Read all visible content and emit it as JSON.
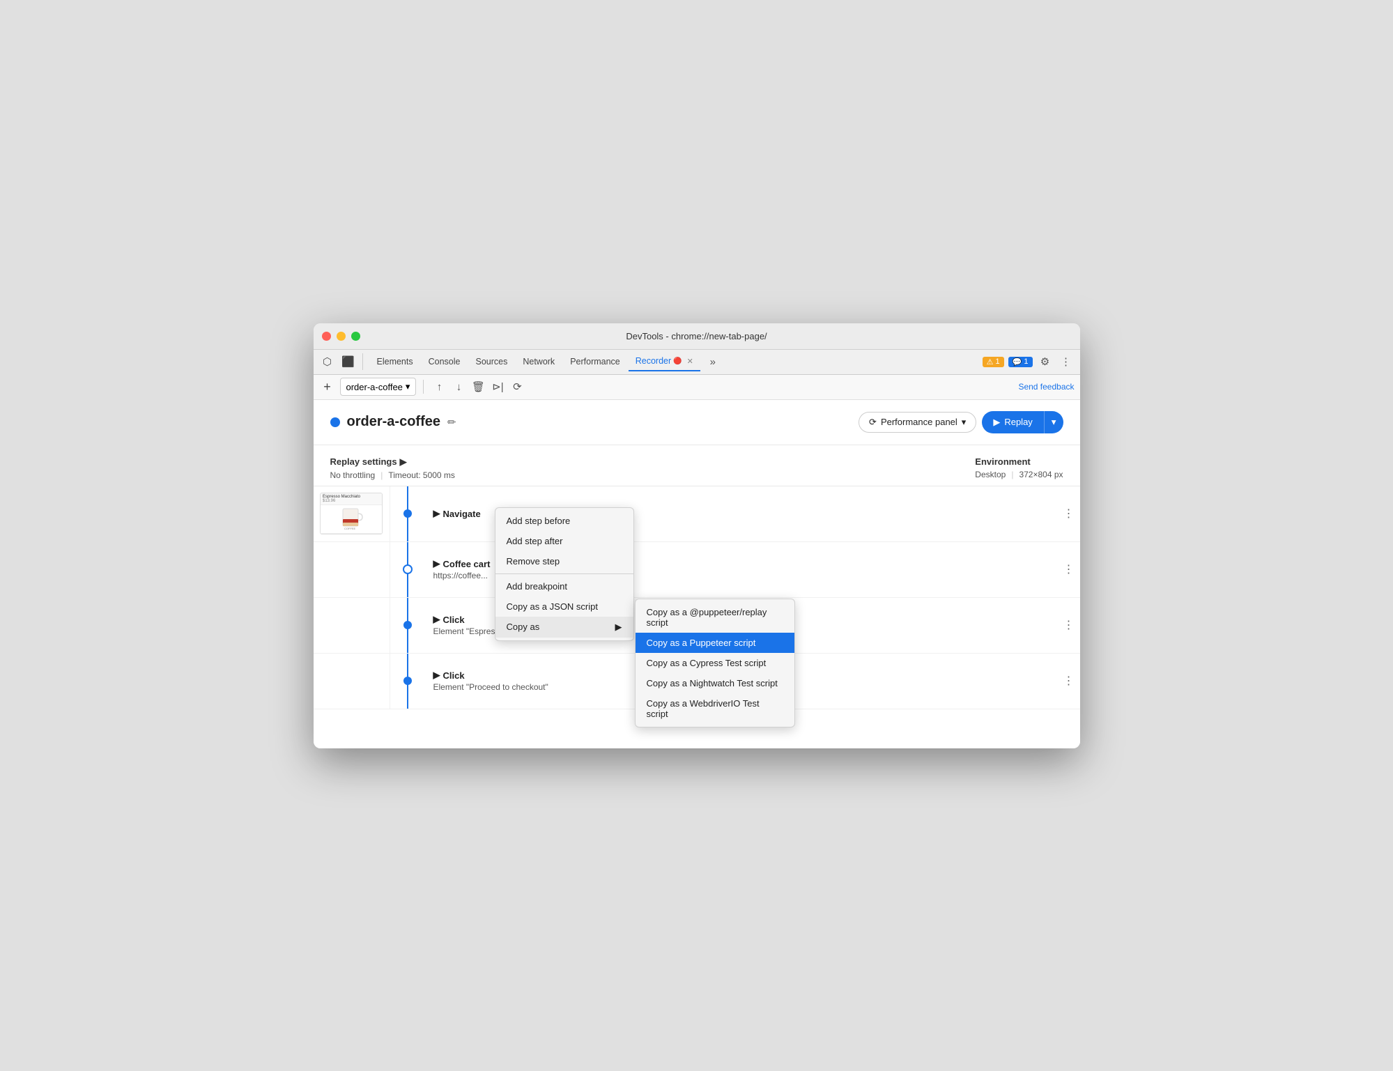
{
  "window": {
    "title": "DevTools - chrome://new-tab-page/"
  },
  "tabs": {
    "items": [
      {
        "label": "Elements",
        "active": false
      },
      {
        "label": "Console",
        "active": false
      },
      {
        "label": "Sources",
        "active": false
      },
      {
        "label": "Network",
        "active": false
      },
      {
        "label": "Performance",
        "active": false
      },
      {
        "label": "Recorder",
        "active": true,
        "closeable": true
      }
    ],
    "more_icon": "»",
    "warn_badge": "⚠ 1",
    "msg_badge": "💬 1",
    "settings_icon": "⚙",
    "more_icon2": "⋮"
  },
  "toolbar": {
    "plus_icon": "+",
    "recording_name": "order-a-coffee",
    "chevron_icon": "▾",
    "export_icon": "↑",
    "import_icon": "↓",
    "delete_icon": "🗑",
    "start_icon": "⊳",
    "settings2_icon": "⟳",
    "send_feedback": "Send feedback"
  },
  "recording": {
    "name": "order-a-coffee",
    "edit_icon": "✏",
    "perf_panel": {
      "label": "Performance panel",
      "icon": "⟳"
    },
    "replay": {
      "label": "Replay",
      "play_icon": "▶",
      "dropdown_icon": "▾"
    }
  },
  "settings": {
    "title": "Replay settings",
    "chevron": "▶",
    "throttling": "No throttling",
    "timeout": "Timeout: 5000 ms",
    "environment_label": "Environment",
    "device": "Desktop",
    "dimensions": "372×804 px"
  },
  "steps": [
    {
      "id": "navigate",
      "name": "Navigate",
      "detail": "",
      "has_preview": true,
      "dot_type": "filled",
      "expanded": false
    },
    {
      "id": "coffee-cart",
      "name": "Coffee cart",
      "detail": "https://coffee...",
      "has_preview": false,
      "dot_type": "outline",
      "expanded": true
    },
    {
      "id": "click-espresso",
      "name": "Click",
      "detail": "Element \"Espresso Macchiato\"",
      "has_preview": false,
      "dot_type": "filled",
      "expanded": false
    },
    {
      "id": "click-checkout",
      "name": "Click",
      "detail": "Element \"Proceed to checkout\"",
      "has_preview": false,
      "dot_type": "filled",
      "expanded": false
    }
  ],
  "context_menu": {
    "items": [
      {
        "label": "Add step before",
        "type": "item"
      },
      {
        "label": "Add step after",
        "type": "item"
      },
      {
        "label": "Remove step",
        "type": "item"
      },
      {
        "type": "sep"
      },
      {
        "label": "Add breakpoint",
        "type": "item"
      },
      {
        "label": "Copy as a JSON script",
        "type": "item"
      },
      {
        "label": "Copy as",
        "type": "item-arrow",
        "arrow": "▶"
      }
    ]
  },
  "submenu": {
    "items": [
      {
        "label": "Copy as a @puppeteer/replay script",
        "active": false
      },
      {
        "label": "Copy as a Puppeteer script",
        "active": true
      },
      {
        "label": "Copy as a Cypress Test script",
        "active": false
      },
      {
        "label": "Copy as a Nightwatch Test script",
        "active": false
      },
      {
        "label": "Copy as a WebdriverIO Test script",
        "active": false
      }
    ]
  }
}
